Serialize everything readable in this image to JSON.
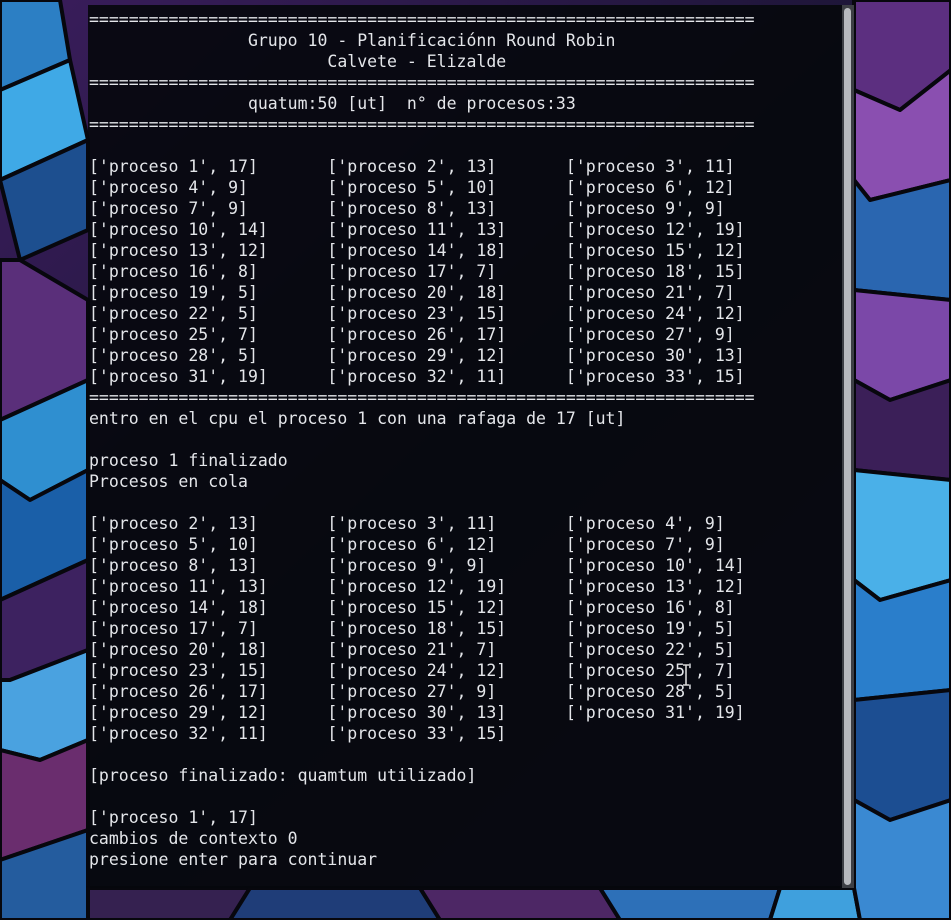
{
  "terminal": {
    "lines": [
      "===================================================================",
      "                Grupo 10 - Planificaciónn Round Robin",
      "                        Calvete - Elizalde",
      "===================================================================",
      "                quatum:50 [ut]  n° de procesos:33",
      "===================================================================",
      "",
      "['proceso 1', 17]       ['proceso 2', 13]       ['proceso 3', 11]",
      "['proceso 4', 9]        ['proceso 5', 10]       ['proceso 6', 12]",
      "['proceso 7', 9]        ['proceso 8', 13]       ['proceso 9', 9]",
      "['proceso 10', 14]      ['proceso 11', 13]      ['proceso 12', 19]",
      "['proceso 13', 12]      ['proceso 14', 18]      ['proceso 15', 12]",
      "['proceso 16', 8]       ['proceso 17', 7]       ['proceso 18', 15]",
      "['proceso 19', 5]       ['proceso 20', 18]      ['proceso 21', 7]",
      "['proceso 22', 5]       ['proceso 23', 15]      ['proceso 24', 12]",
      "['proceso 25', 7]       ['proceso 26', 17]      ['proceso 27', 9]",
      "['proceso 28', 5]       ['proceso 29', 12]      ['proceso 30', 13]",
      "['proceso 31', 19]      ['proceso 32', 11]      ['proceso 33', 15]",
      "===================================================================",
      "entro en el cpu el proceso 1 con una rafaga de 17 [ut]",
      "",
      "proceso 1 finalizado",
      "Procesos en cola",
      "",
      "['proceso 2', 13]       ['proceso 3', 11]       ['proceso 4', 9]",
      "['proceso 5', 10]       ['proceso 6', 12]       ['proceso 7', 9]",
      "['proceso 8', 13]       ['proceso 9', 9]        ['proceso 10', 14]",
      "['proceso 11', 13]      ['proceso 12', 19]      ['proceso 13', 12]",
      "['proceso 14', 18]      ['proceso 15', 12]      ['proceso 16', 8]",
      "['proceso 17', 7]       ['proceso 18', 15]      ['proceso 19', 5]",
      "['proceso 20', 18]      ['proceso 21', 7]       ['proceso 22', 5]",
      "['proceso 23', 15]      ['proceso 24', 12]      ['proceso 25', 7]",
      "['proceso 26', 17]      ['proceso 27', 9]       ['proceso 28', 5]",
      "['proceso 29', 12]      ['proceso 30', 13]      ['proceso 31', 19]",
      "['proceso 32', 11]      ['proceso 33', 15]",
      "",
      "[proceso finalizado: quamtum utilizado]",
      "",
      "['proceso 1', 17]",
      "cambios de contexto 0",
      "presione enter para continuar"
    ]
  },
  "colors": {
    "terminal_bg": "#06080c",
    "terminal_fg": "#e4e6ea",
    "scrollbar_track": "#3d3f45",
    "scrollbar_thumb": "#b7b9be"
  },
  "icons": {
    "text_cursor": "i-beam-cursor-icon"
  }
}
